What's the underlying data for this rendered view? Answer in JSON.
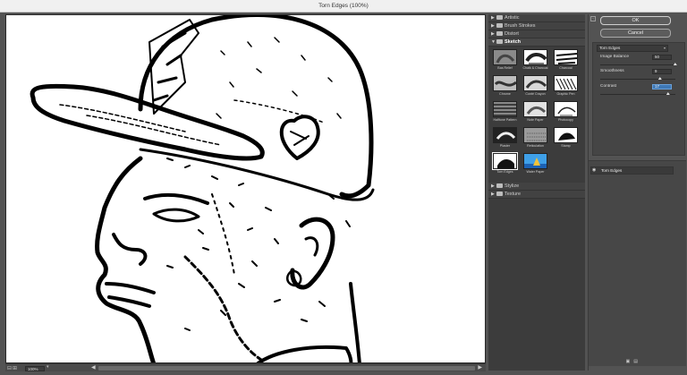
{
  "window": {
    "title": "Torn Edges (100%)"
  },
  "status": {
    "zoom": "100%"
  },
  "categories_before": [
    {
      "label": "Artistic"
    },
    {
      "label": "Brush Strokes"
    },
    {
      "label": "Distort"
    }
  ],
  "open_category": {
    "label": "Sketch"
  },
  "thumbnails": [
    {
      "label": "Bas Relief"
    },
    {
      "label": "Chalk & Charcoal"
    },
    {
      "label": "Charcoal"
    },
    {
      "label": "Chrome"
    },
    {
      "label": "Conté Crayon"
    },
    {
      "label": "Graphic Pen"
    },
    {
      "label": "Halftone Pattern"
    },
    {
      "label": "Note Paper"
    },
    {
      "label": "Photocopy"
    },
    {
      "label": "Plaster"
    },
    {
      "label": "Reticulation"
    },
    {
      "label": "Stamp"
    },
    {
      "label": "Torn Edges",
      "selected": true
    },
    {
      "label": "Water Paper"
    }
  ],
  "categories_after": [
    {
      "label": "Stylize"
    },
    {
      "label": "Texture"
    }
  ],
  "buttons": {
    "ok": "OK",
    "cancel": "Cancel"
  },
  "settings": {
    "filter_name": "Torn Edges",
    "image_balance": {
      "label": "Image Balance",
      "value": "50",
      "fraction": 1.0
    },
    "smoothness": {
      "label": "Smoothness",
      "value": "9",
      "fraction": 0.8
    },
    "contrast": {
      "label": "Contrast",
      "value": "17",
      "fraction": 0.9
    }
  },
  "layers": [
    {
      "name": "Torn Edges"
    }
  ],
  "colors": {
    "panel": "#535353",
    "list_bg": "#3c3c3c",
    "accent": "#3e78b5"
  }
}
